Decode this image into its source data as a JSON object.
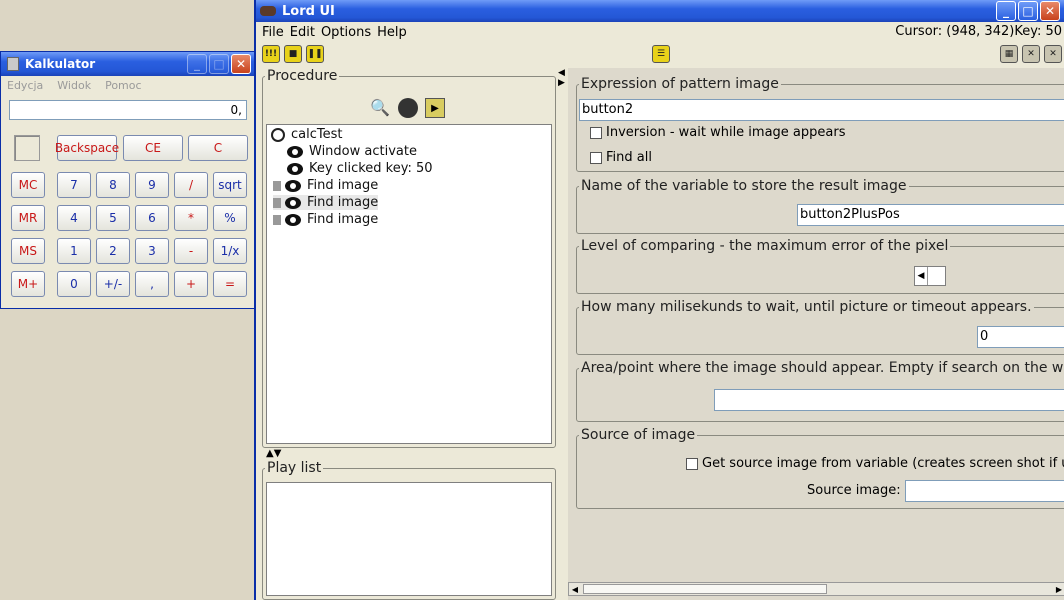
{
  "calculator": {
    "title": "Kalkulator",
    "menu": [
      "Edycja",
      "Widok",
      "Pomoc"
    ],
    "display": "0,",
    "buttons": {
      "backspace": "Backspace",
      "ce": "CE",
      "c": "C",
      "mc": "MC",
      "mr": "MR",
      "ms": "MS",
      "mplus": "M+",
      "d7": "7",
      "d8": "8",
      "d9": "9",
      "div": "/",
      "sqrt": "sqrt",
      "d4": "4",
      "d5": "5",
      "d6": "6",
      "mul": "*",
      "pct": "%",
      "d1": "1",
      "d2": "2",
      "d3": "3",
      "sub": "-",
      "inv": "1/x",
      "d0": "0",
      "sign": "+/-",
      "dec": ",",
      "add": "+",
      "eq": "="
    }
  },
  "lord": {
    "title": "Lord UI",
    "menu": {
      "file": "File",
      "edit": "Edit",
      "options": "Options",
      "help": "Help"
    },
    "cursor": "Cursor: (948, 342)Key: 50",
    "procedure": {
      "legend": "Procedure",
      "root": "calcTest",
      "items": [
        "Window activate",
        "Key clicked key: 50",
        "Find image",
        "Find image",
        "Find image"
      ]
    },
    "playlist": {
      "legend": "Play list"
    },
    "form": {
      "expr_legend": "Expression of pattern image",
      "expr_value": "button2",
      "inversion_label": "Inversion - wait while image appears",
      "findall_label": "Find all",
      "var_legend": "Name of the variable to store the result image",
      "var_value": "button2PlusPos",
      "level_legend": "Level of comparing - the maximum error of the pixel",
      "wait_legend": "How many milisekunds to wait, until picture or timeout appears.",
      "wait_value": "0",
      "area_legend": "Area/point where the image should appear. Empty if search on the w",
      "area_value": "",
      "source_legend": "Source of image",
      "source_check_label": "Get source image from variable (creates screen shot if unch",
      "source_image_label": "Source image:",
      "source_image_value": ""
    }
  }
}
